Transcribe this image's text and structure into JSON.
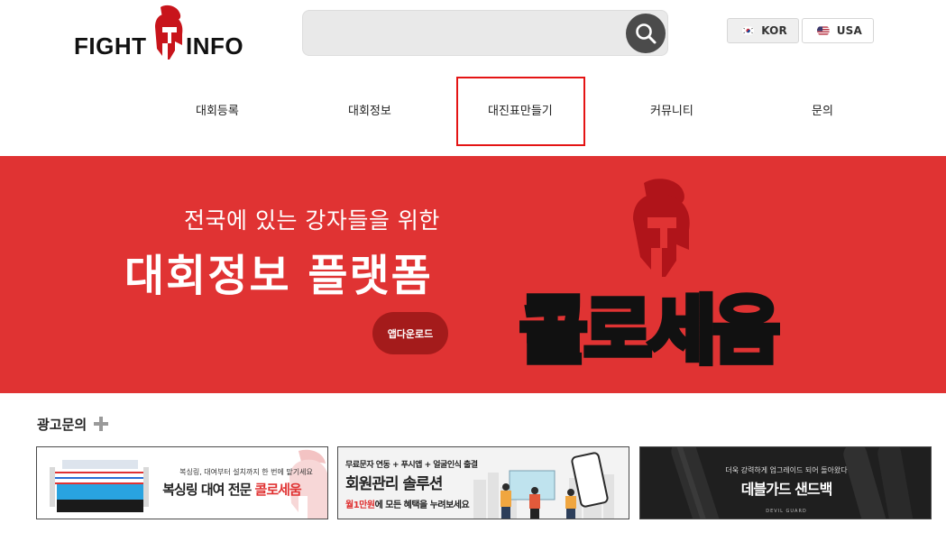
{
  "header": {
    "logo_left": "FIGHT",
    "logo_right": "INFO",
    "search": {
      "value": "",
      "placeholder": ""
    },
    "languages": [
      {
        "label": "KOR"
      },
      {
        "label": "USA"
      }
    ]
  },
  "nav": {
    "items": [
      {
        "label": "대회등록"
      },
      {
        "label": "대회정보"
      },
      {
        "label": "대진표만들기"
      },
      {
        "label": "커뮤니티"
      },
      {
        "label": "문의"
      }
    ]
  },
  "banner": {
    "subtitle": "전국에 있는 강자들을 위한",
    "title": "대회정보 플랫폼",
    "button": "앱다운로드",
    "brand": "콜로세움"
  },
  "ads": {
    "title": "광고문의",
    "items": [
      {
        "line1": "복싱링, 대여부터 설치까지 한 번에 맡기세요",
        "line2a": "복싱링 대여 전문 ",
        "line2b": "콜로세움"
      },
      {
        "line1": "무료문자 연동 + 푸시앱 + 얼굴인식 출결",
        "line2": "회원관리 솔루션",
        "line3a": "월1만원",
        "line3b": "에 모든 혜택을 누려보세요"
      },
      {
        "line1": "더욱 강력하게 업그레이드 되어 돌아왔다",
        "line2": "데블가드 샌드백",
        "line3": "DEVIL GUARD"
      }
    ]
  },
  "colors": {
    "brand_red": "#e03333",
    "button_dark_red": "#a41b1b",
    "highlight": "#e41414"
  }
}
